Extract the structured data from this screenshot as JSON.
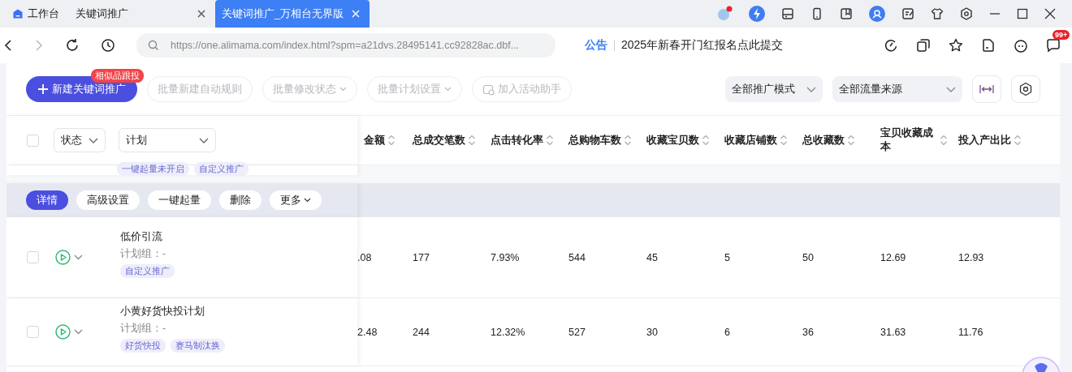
{
  "browser_tabs": [
    {
      "label": "工作台",
      "kind": "home",
      "selected": false
    },
    {
      "label": "关键词推广",
      "kind": "page",
      "selected": false
    },
    {
      "label": "关键词推广_万相台无界版",
      "kind": "page",
      "selected": true
    }
  ],
  "address_bar": {
    "url": "https://one.alimama.com/index.html?spm=a21dvs.28495141.cc92828ac.dbf..."
  },
  "notice": {
    "label": "公告",
    "text": "2025年新春开门红报名点此提交"
  },
  "message_badge": "99+",
  "toolbar": {
    "primary": {
      "label": "新建关键词推广",
      "badge": "相似品跟投"
    },
    "buttons": [
      {
        "label": "批量新建自动规则",
        "kind": "plain",
        "disabled": true
      },
      {
        "label": "批量修改状态",
        "kind": "menu",
        "disabled": true
      },
      {
        "label": "批量计划设置",
        "kind": "menu",
        "disabled": true
      },
      {
        "label": "加入活动助手",
        "kind": "icon",
        "disabled": true
      }
    ],
    "selects": [
      {
        "value": "全部推广模式"
      },
      {
        "value": "全部流量来源"
      }
    ]
  },
  "table": {
    "select_all": {
      "checked": false
    },
    "filters": [
      {
        "value": "状态"
      },
      {
        "value": "计划"
      }
    ],
    "columns": [
      "金额",
      "总成交笔数",
      "点击转化率",
      "总购物车数",
      "收藏宝贝数",
      "收藏店铺数",
      "总收藏数",
      "宝贝收藏成本",
      "投入产出比"
    ],
    "partial_row_tags": [
      "一键起量未开启",
      "自定义推广"
    ],
    "row_actions": [
      {
        "label": "详情",
        "selected": true
      },
      {
        "label": "高级设置",
        "selected": false
      },
      {
        "label": "一键起量",
        "selected": false
      },
      {
        "label": "删除",
        "selected": false
      },
      {
        "label": "更多",
        "selected": false,
        "kind": "menu"
      }
    ],
    "rows": [
      {
        "checked": false,
        "name": "低价引流",
        "group": "计划组：-",
        "tags": [
          "自定义推广"
        ],
        "cells": [
          ".08",
          "177",
          "7.93%",
          "544",
          "45",
          "5",
          "50",
          "12.69",
          "12.93"
        ]
      },
      {
        "checked": false,
        "name": "小黄好货快投计划",
        "group": "计划组：-",
        "tags": [
          "好货快投",
          "赛马制汰换"
        ],
        "cells": [
          "2.48",
          "244",
          "12.32%",
          "527",
          "30",
          "6",
          "36",
          "31.63",
          "11.76"
        ]
      }
    ]
  }
}
